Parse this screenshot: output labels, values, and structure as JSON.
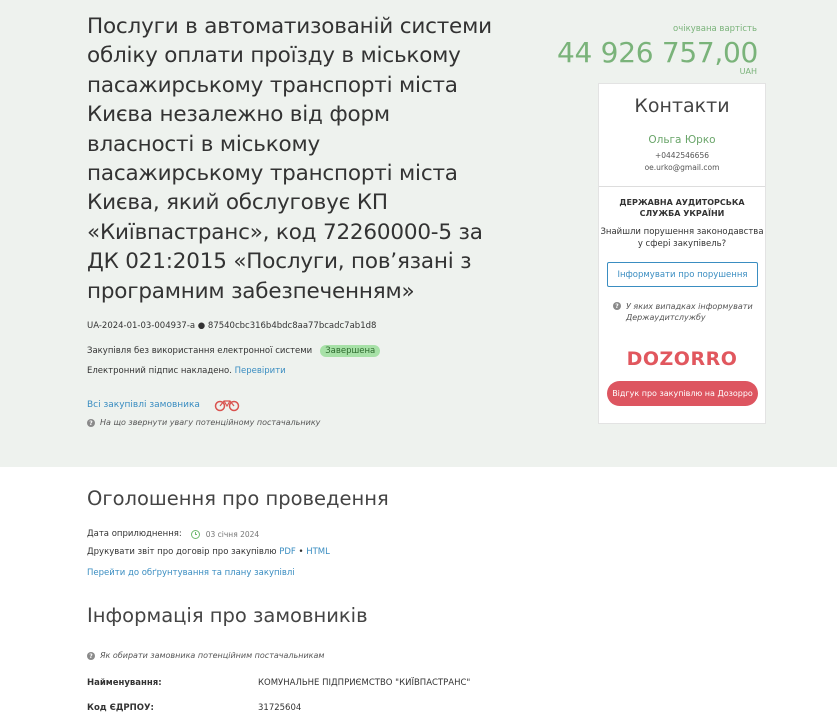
{
  "tender": {
    "title": "Послуги в автоматизованій системи обліку оплати проїзду в міському пасажирському транспорті міста Києва незалежно від форм власності в міському пасажирському транспорті міста Києва, який обслуговує КП «Київпастранс», код 72260000-5 за ДК 021:2015 «Послуги, пов’язані з програмним забезпеченням»",
    "id_line": "UA-2024-01-03-004937-a ● 87540cbc316b4bdc8aa77bcadc7ab1d8",
    "procedure_type": "Закупівля без використання електронної системи",
    "status": "Завершена",
    "signature_text": "Електронний підпис накладено.",
    "signature_link": "Перевірити",
    "all_purchases_link": "Всі закупівлі замовника",
    "supplier_tip": "На що звернути увагу потенційному постачальнику"
  },
  "price": {
    "label": "очікувана вартість",
    "amount": "44 926 757,00",
    "currency": "UAH"
  },
  "contacts": {
    "title": "Контакти",
    "name": "Ольга Юрко",
    "phone": "+0442546656",
    "email": "oe.urko@gmail.com"
  },
  "audit": {
    "title": "ДЕРЖАВНА АУДИТОРСЬКА СЛУЖБА УКРАЇНИ",
    "text": "Знайшли порушення законодавства у сфері закупівель?",
    "button": "Інформувати про порушення",
    "tip": "У яких випадках інформувати Держаудитслужбу"
  },
  "dozorro": {
    "logo": "DOZORRO",
    "button": "Відгук про закупівлю на Дозорро"
  },
  "announcement": {
    "title": "Оголошення про проведення",
    "date_label": "Дата оприлюднення:",
    "date_value": "03 січня 2024",
    "print_label": "Друкувати звіт про договір про закупівлю",
    "pdf": "PDF",
    "separator": "•",
    "html": "HTML",
    "plan_link": "Перейти до обґрунтування та плану закупівлі"
  },
  "customers": {
    "title": "Інформація про замовників",
    "tip": "Як обирати замовника потенційним постачальникам",
    "name_label": "Найменування:",
    "name_value": "КОМУНАЛЬНЕ ПІДПРИЄМСТВО \"КИЇВПАСТРАНС\"",
    "code_label": "Код ЄДРПОУ:",
    "code_value": "31725604"
  },
  "colors": {
    "top_background": "#eef2ee",
    "price_green": "#7ab37a",
    "link_blue": "#3a8dc1",
    "dozorro_red": "#dd5560",
    "status_badge": "#a7e1a7"
  }
}
